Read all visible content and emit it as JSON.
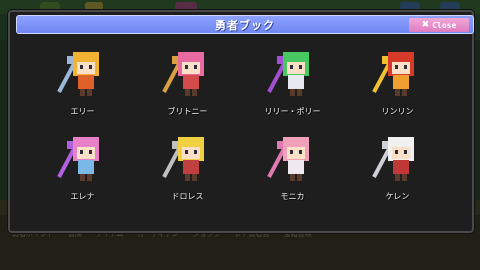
{
  "window": {
    "title": "勇者ブック",
    "close_label": "Close"
  },
  "heroes": [
    {
      "name": "エリー",
      "hair": "#f2b233",
      "outfit": "#e0602a",
      "item": "#9bb8d8"
    },
    {
      "name": "ブリトニー",
      "hair": "#e86aa0",
      "outfit": "#d24a4a",
      "item": "#d8a040"
    },
    {
      "name": "リリー・ポリー",
      "hair": "#48c860",
      "outfit": "#e8e8f0",
      "item": "#a050d0"
    },
    {
      "name": "リンリン",
      "hair": "#d83a2a",
      "outfit": "#f0a030",
      "item": "#f0c030"
    },
    {
      "name": "エレナ",
      "hair": "#e880c8",
      "outfit": "#7ab8e8",
      "item": "#b060e0"
    },
    {
      "name": "ドロレス",
      "hair": "#f0d040",
      "outfit": "#c04040",
      "item": "#c0c0c0"
    },
    {
      "name": "モニカ",
      "hair": "#f0a0b8",
      "outfit": "#f0e8f0",
      "item": "#e07ab0"
    },
    {
      "name": "ケレン",
      "hair": "#f0f0f0",
      "outfit": "#c03838",
      "item": "#d0d0d8"
    }
  ],
  "background_bar": [
    "勇者ポイント",
    "冒険",
    "アイテム",
    "ガーディアン",
    "ショップ",
    "レア勇者召",
    "宝箱召喚"
  ]
}
